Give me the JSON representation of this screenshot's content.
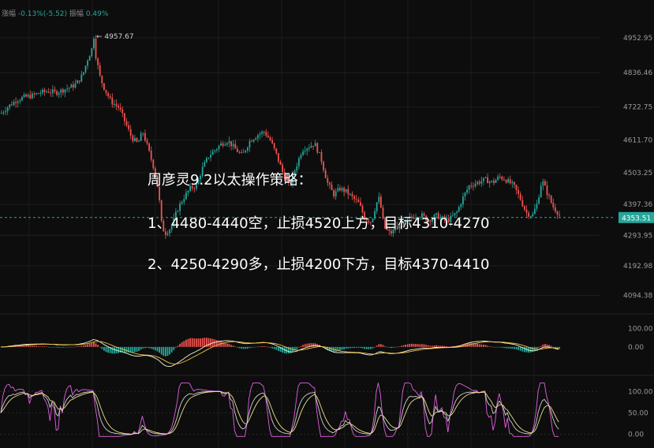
{
  "header": {
    "change_label": "涨幅",
    "change_value": "-0.13%(-5.52)",
    "amplitude_label": "振幅",
    "amplitude_value": "0.49%"
  },
  "overlay": {
    "title": "周彦灵9.2以太操作策略：",
    "line1": "1、4480-4440空，止损4520上方，目标4310-4270",
    "line2": "2、4250-4290多，止损4200下方，目标4370-4410"
  },
  "colors": {
    "up": "#26a69a",
    "down": "#ef5350",
    "background": "#0d0d0d",
    "price_tag": "#26a69a",
    "macd_fast": "#f5f5dc",
    "macd_slow": "#f0c040",
    "kdj_k": "#e060e0",
    "kdj_d": "#f0e08a",
    "kdj_j": "#d0d0d0"
  },
  "chart_data": [
    {
      "type": "candlestick",
      "title": "",
      "y_ticks": [
        4952.95,
        4836.46,
        4722.75,
        4611.7,
        4503.25,
        4397.36,
        4293.95,
        4192.98,
        4094.38
      ],
      "ylim": [
        4040,
        5000
      ],
      "current_price": 4353.51,
      "high_marker": 4957.67,
      "close_path": [
        [
          0,
          4700
        ],
        [
          10,
          4725
        ],
        [
          20,
          4745
        ],
        [
          30,
          4755
        ],
        [
          40,
          4760
        ],
        [
          50,
          4770
        ],
        [
          60,
          4775
        ],
        [
          70,
          4770
        ],
        [
          80,
          4780
        ],
        [
          90,
          4790
        ],
        [
          96,
          4800
        ],
        [
          104,
          4830
        ],
        [
          110,
          4880
        ],
        [
          116,
          4920
        ],
        [
          118,
          4957
        ],
        [
          120,
          4900
        ],
        [
          126,
          4820
        ],
        [
          132,
          4780
        ],
        [
          140,
          4740
        ],
        [
          150,
          4720
        ],
        [
          158,
          4670
        ],
        [
          166,
          4620
        ],
        [
          174,
          4600
        ],
        [
          180,
          4640
        ],
        [
          186,
          4590
        ],
        [
          194,
          4520
        ],
        [
          200,
          4440
        ],
        [
          204,
          4330
        ],
        [
          208,
          4300
        ],
        [
          216,
          4320
        ],
        [
          224,
          4380
        ],
        [
          232,
          4420
        ],
        [
          240,
          4450
        ],
        [
          248,
          4460
        ],
        [
          256,
          4520
        ],
        [
          264,
          4560
        ],
        [
          272,
          4580
        ],
        [
          280,
          4600
        ],
        [
          288,
          4610
        ],
        [
          298,
          4580
        ],
        [
          306,
          4560
        ],
        [
          316,
          4610
        ],
        [
          326,
          4630
        ],
        [
          334,
          4640
        ],
        [
          342,
          4610
        ],
        [
          350,
          4560
        ],
        [
          358,
          4500
        ],
        [
          366,
          4460
        ],
        [
          374,
          4520
        ],
        [
          382,
          4580
        ],
        [
          390,
          4590
        ],
        [
          398,
          4600
        ],
        [
          406,
          4550
        ],
        [
          414,
          4470
        ],
        [
          422,
          4430
        ],
        [
          430,
          4450
        ],
        [
          438,
          4440
        ],
        [
          446,
          4420
        ],
        [
          454,
          4400
        ],
        [
          462,
          4350
        ],
        [
          470,
          4340
        ],
        [
          476,
          4400
        ],
        [
          480,
          4420
        ],
        [
          486,
          4320
        ],
        [
          494,
          4300
        ],
        [
          502,
          4320
        ],
        [
          510,
          4330
        ],
        [
          518,
          4350
        ],
        [
          526,
          4360
        ],
        [
          534,
          4360
        ],
        [
          542,
          4345
        ],
        [
          552,
          4360
        ],
        [
          560,
          4350
        ],
        [
          568,
          4345
        ],
        [
          578,
          4370
        ],
        [
          586,
          4420
        ],
        [
          594,
          4460
        ],
        [
          604,
          4470
        ],
        [
          614,
          4480
        ],
        [
          624,
          4470
        ],
        [
          632,
          4490
        ],
        [
          640,
          4480
        ],
        [
          650,
          4460
        ],
        [
          658,
          4420
        ],
        [
          666,
          4370
        ],
        [
          674,
          4360
        ],
        [
          680,
          4400
        ],
        [
          686,
          4480
        ],
        [
          692,
          4440
        ],
        [
          700,
          4390
        ],
        [
          706,
          4370
        ],
        [
          710,
          4353
        ]
      ]
    },
    {
      "type": "macd",
      "y_ticks": [
        100.0,
        0.0
      ],
      "ylim": [
        -130,
        150
      ]
    },
    {
      "type": "kdj",
      "y_ticks": [
        100.0,
        50.0,
        0.0
      ],
      "ylim": [
        -10,
        130
      ]
    }
  ]
}
